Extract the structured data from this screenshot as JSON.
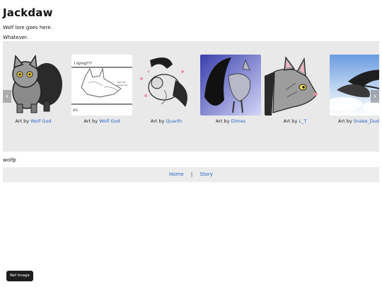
{
  "page": {
    "title": "Jackdaw",
    "lore": "Wolf lore goes here.",
    "subtitle": "Whatever.",
    "footer_text": "wolfp"
  },
  "gallery": {
    "prev_icon": "‹",
    "next_icon": "›",
    "credit_prefix": "Art by",
    "items": [
      {
        "artist": "Wolf God",
        "image": "chibi-wolf-with-wings"
      },
      {
        "artist": "Wolf God",
        "image": "sketch-wolf-lying-down"
      },
      {
        "artist": "Quarth",
        "image": "curled-wolf-with-wings"
      },
      {
        "artist": "Dimes",
        "image": "winged-wolf-blue-background"
      },
      {
        "artist": "L_T",
        "image": "wolf-headshot"
      },
      {
        "artist": "Snake_Dude",
        "image": "wolf-flying-sky"
      }
    ]
  },
  "nav": {
    "home": "Home",
    "separator": "|",
    "story": "Story"
  },
  "ref_button": "Ref image",
  "colors": {
    "link": "#2466c8",
    "gallery_bg": "#e9e9e9",
    "nav_bg": "#ececec",
    "button_bg": "#1e1e1e"
  }
}
